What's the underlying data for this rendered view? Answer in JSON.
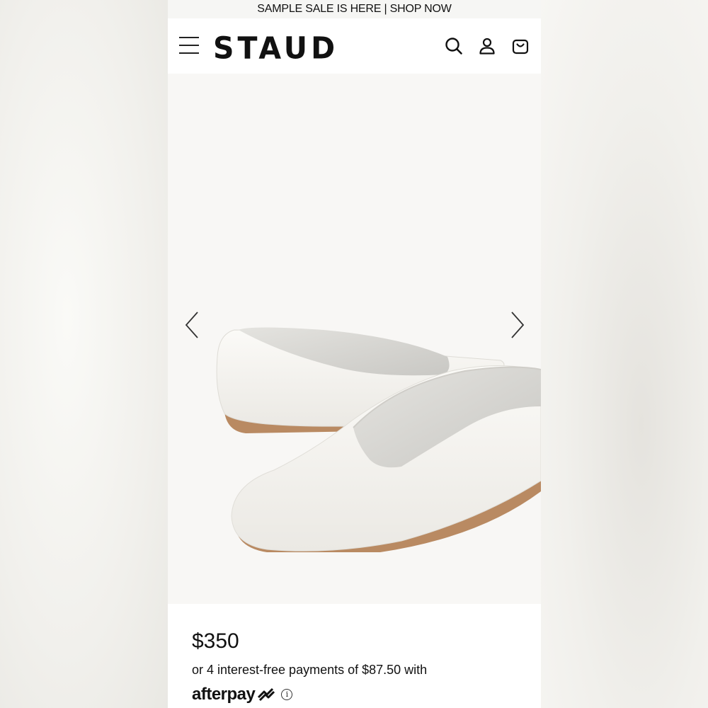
{
  "promo": {
    "text": "SAMPLE SALE IS HERE | SHOP NOW"
  },
  "header": {
    "logo": "STAUD",
    "icons": [
      "menu-icon",
      "search-icon",
      "account-icon",
      "cart-icon"
    ]
  },
  "gallery": {
    "image": "white-leather-ballet-flats",
    "prev_icon": "chevron-left-icon",
    "next_icon": "chevron-right-icon"
  },
  "product": {
    "price": "$350",
    "installments": "or 4 interest-free payments of $87.50 with",
    "afterpay_label": "afterpay",
    "info_symbol": "i"
  },
  "colors": {
    "text": "#111111",
    "hero_bg": "#f8f7f5",
    "shoe": "#f4f3ef",
    "sole": "#b98a62"
  }
}
